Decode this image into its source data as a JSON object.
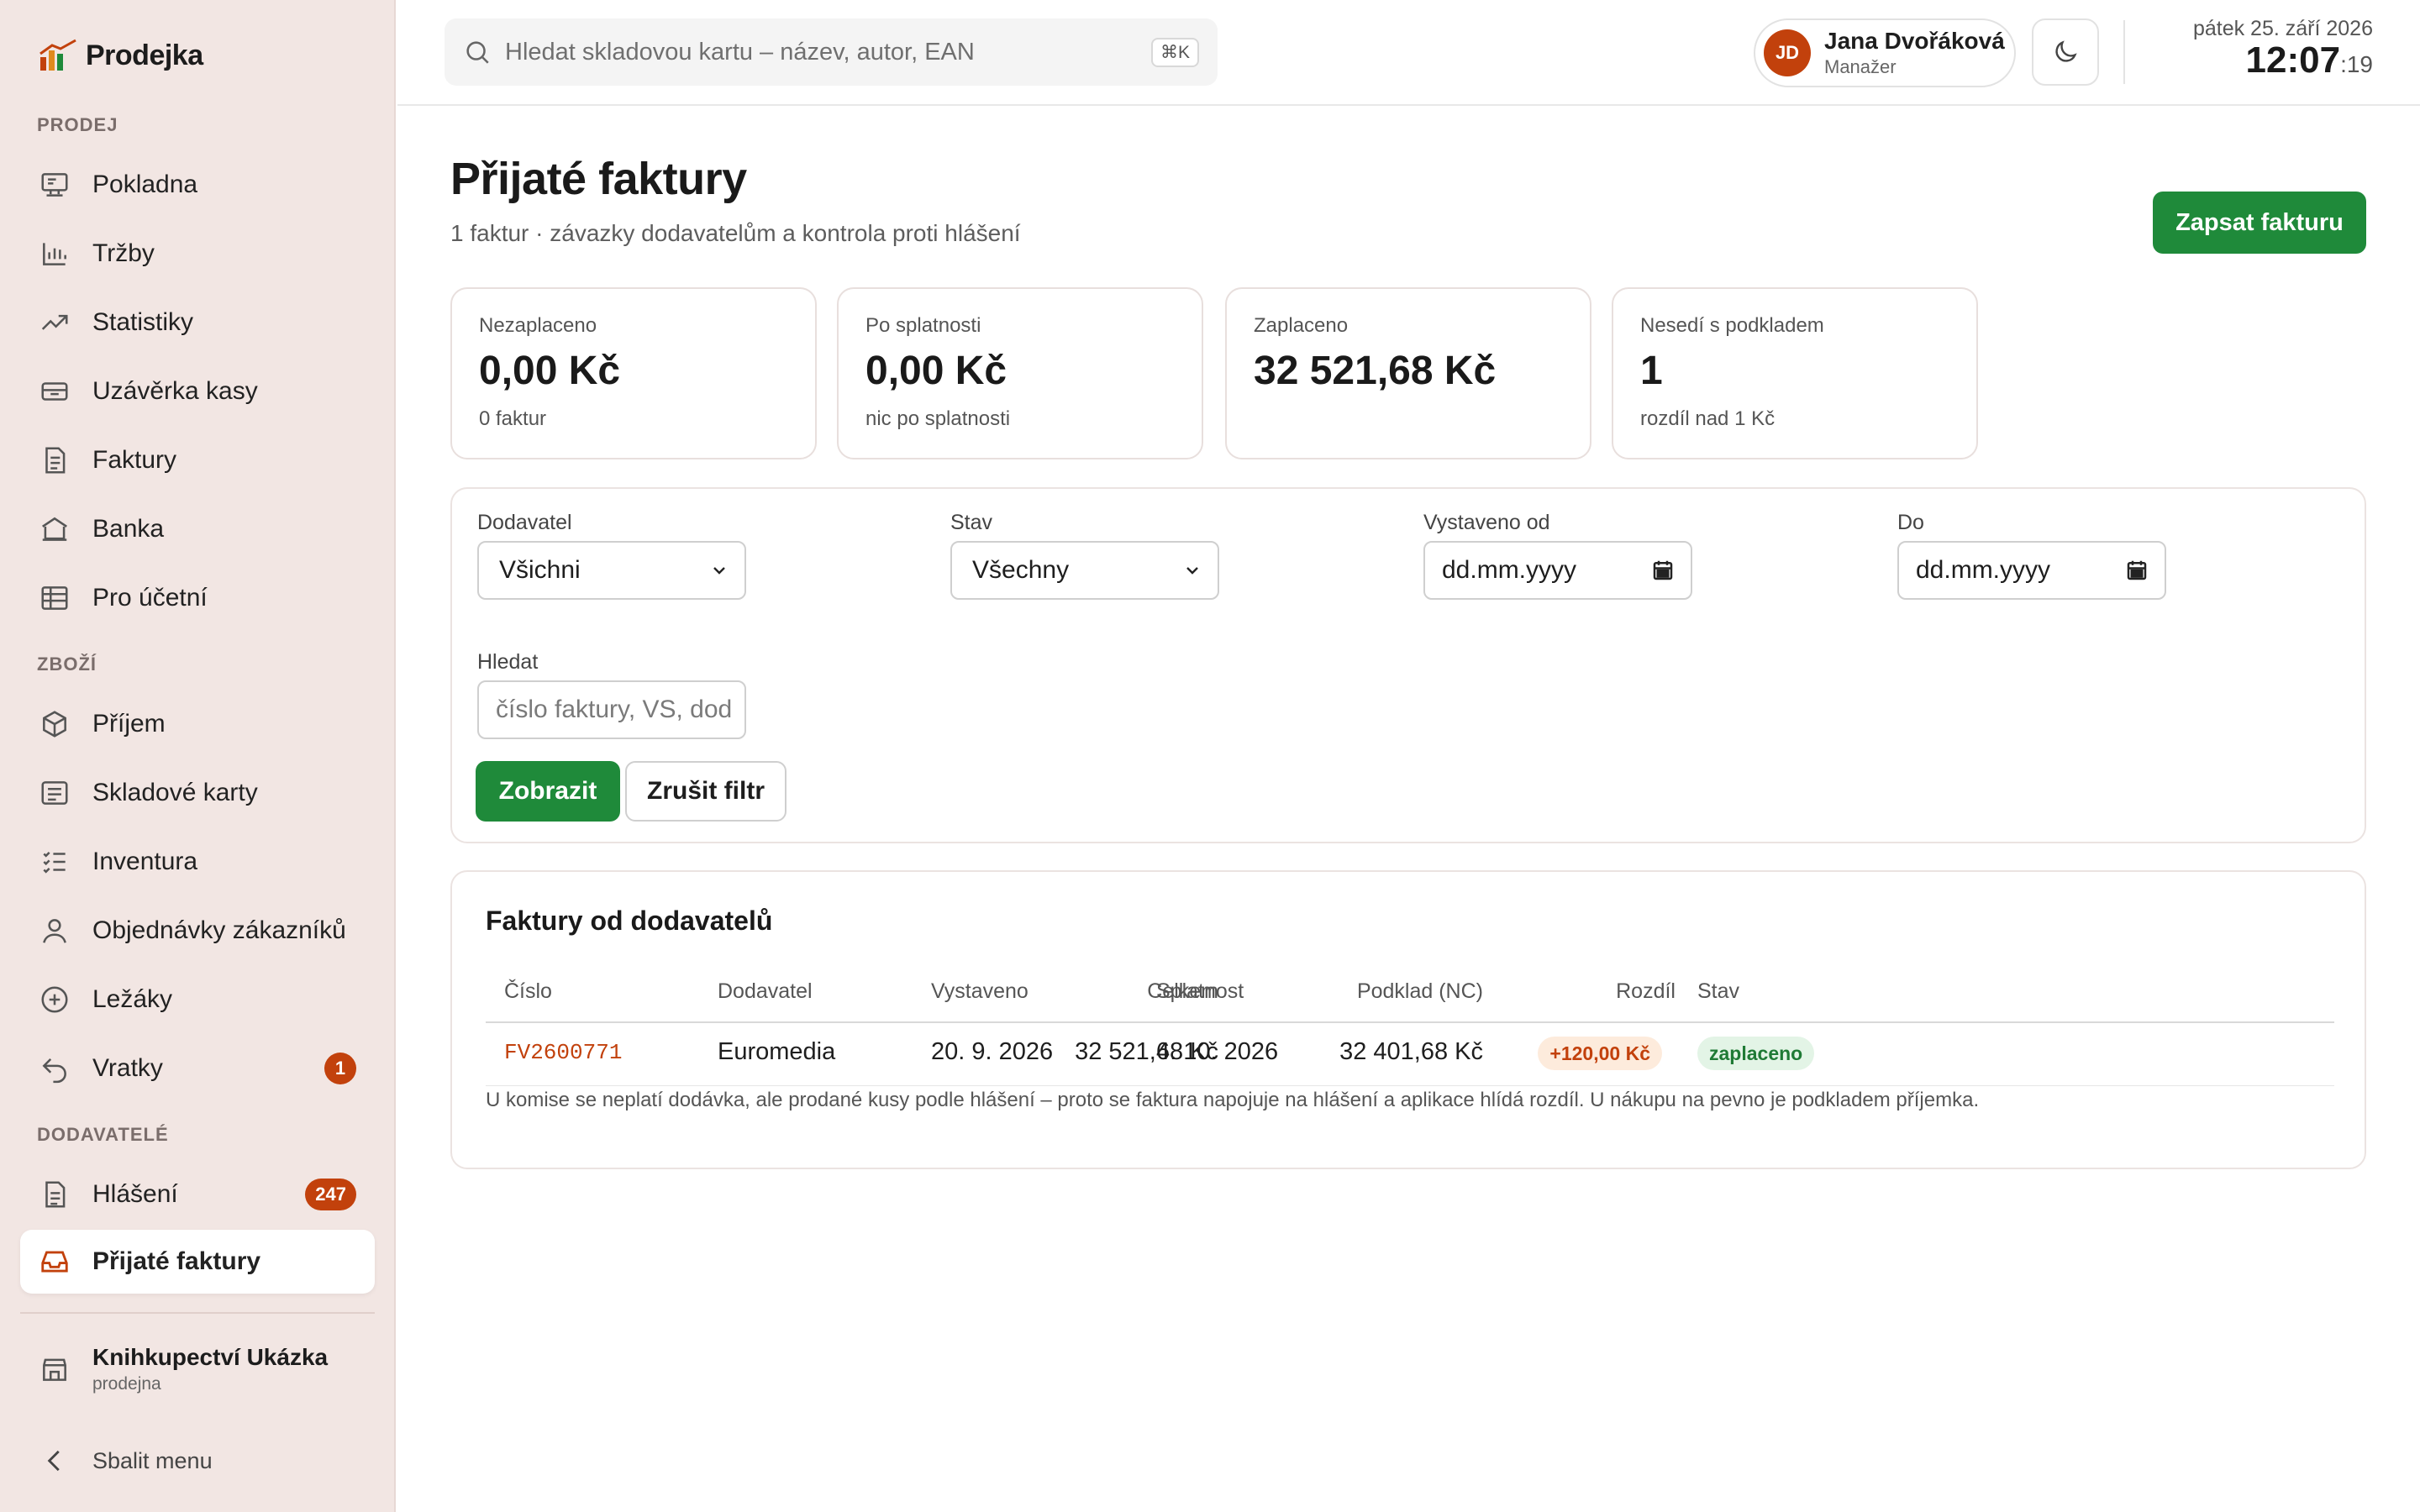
{
  "app": {
    "name": "Prodejka"
  },
  "sidebar": {
    "sections": [
      {
        "label": "PRODEJ"
      },
      {
        "label": "ZBOŽÍ"
      },
      {
        "label": "DODAVATELÉ"
      }
    ],
    "items": [
      {
        "label": "Pokladna",
        "icon": "register-icon"
      },
      {
        "label": "Tržby",
        "icon": "bar-chart-icon"
      },
      {
        "label": "Statistiky",
        "icon": "trend-icon"
      },
      {
        "label": "Uzávěrka kasy",
        "icon": "cash-drawer-icon"
      },
      {
        "label": "Faktury",
        "icon": "document-icon"
      },
      {
        "label": "Banka",
        "icon": "bank-icon"
      },
      {
        "label": "Pro účetní",
        "icon": "table-icon"
      },
      {
        "label": "Příjem",
        "icon": "box-icon"
      },
      {
        "label": "Skladové karty",
        "icon": "card-list-icon"
      },
      {
        "label": "Inventura",
        "icon": "checklist-icon"
      },
      {
        "label": "Objednávky zákazníků",
        "icon": "user-icon"
      },
      {
        "label": "Ležáky",
        "icon": "plus-circle-icon"
      },
      {
        "label": "Vratky",
        "icon": "return-icon",
        "badge": "1"
      },
      {
        "label": "Hlášení",
        "icon": "report-icon",
        "badge": "247"
      },
      {
        "label": "Přijaté faktury",
        "icon": "inbox-icon",
        "active": true
      }
    ],
    "store": {
      "name": "Knihkupectví Ukázka",
      "type": "prodejna"
    },
    "collapse_label": "Sbalit menu"
  },
  "topbar": {
    "search_placeholder": "Hledat skladovou kartu – název, autor, EAN",
    "search_shortcut": "⌘K",
    "user": {
      "initials": "JD",
      "name": "Jana Dvořáková",
      "role": "Manažer"
    },
    "clock": {
      "date": "pátek 25. září 2026",
      "time": "12:07",
      "seconds": ":19"
    }
  },
  "page": {
    "title": "Přijaté faktury",
    "subtitle": "1 faktur · závazky dodavatelům a kontrola proti hlášení",
    "primary_action": "Zapsat fakturu"
  },
  "stats": [
    {
      "label": "Nezaplaceno",
      "value": "0,00 Kč",
      "sub": "0 faktur"
    },
    {
      "label": "Po splatnosti",
      "value": "0,00 Kč",
      "sub": "nic po splatnosti"
    },
    {
      "label": "Zaplaceno",
      "value": "32 521,68 Kč",
      "sub": ""
    },
    {
      "label": "Nesedí s podkladem",
      "value": "1",
      "sub": "rozdíl nad 1 Kč"
    }
  ],
  "filters": {
    "supplier": {
      "label": "Dodavatel",
      "value": "Všichni"
    },
    "status": {
      "label": "Stav",
      "value": "Všechny"
    },
    "issued_from": {
      "label": "Vystaveno od",
      "value": "dd.mm.yyyy"
    },
    "issued_to": {
      "label": "Do",
      "value": "dd.mm.yyyy"
    },
    "search": {
      "label": "Hledat",
      "placeholder": "číslo faktury, VS, dod"
    },
    "show_label": "Zobrazit",
    "clear_label": "Zrušit filtr"
  },
  "table": {
    "title": "Faktury od dodavatelů",
    "columns": [
      "Číslo",
      "Dodavatel",
      "Vystaveno",
      "Splatnost",
      "Celkem",
      "Podklad (NC)",
      "Rozdíl",
      "Stav"
    ],
    "rows": [
      {
        "number": "FV2600771",
        "supplier": "Euromedia",
        "issued": "20. 9. 2026",
        "due": "4. 10. 2026",
        "total": "32 521,68 Kč",
        "basis": "32 401,68 Kč",
        "difference": "+120,00 Kč",
        "status": "zaplaceno"
      }
    ],
    "note": "U komise se neplatí dodávka, ale prodané kusy podle hlášení – proto se faktura napojuje na hlášení a aplikace hlídá rozdíl. U nákupu na pevno je podkladem příjemka."
  },
  "colors": {
    "sidebar_bg": "#f2e6e3",
    "accent_green": "#1f8a3a",
    "accent_orange": "#c2410c"
  }
}
